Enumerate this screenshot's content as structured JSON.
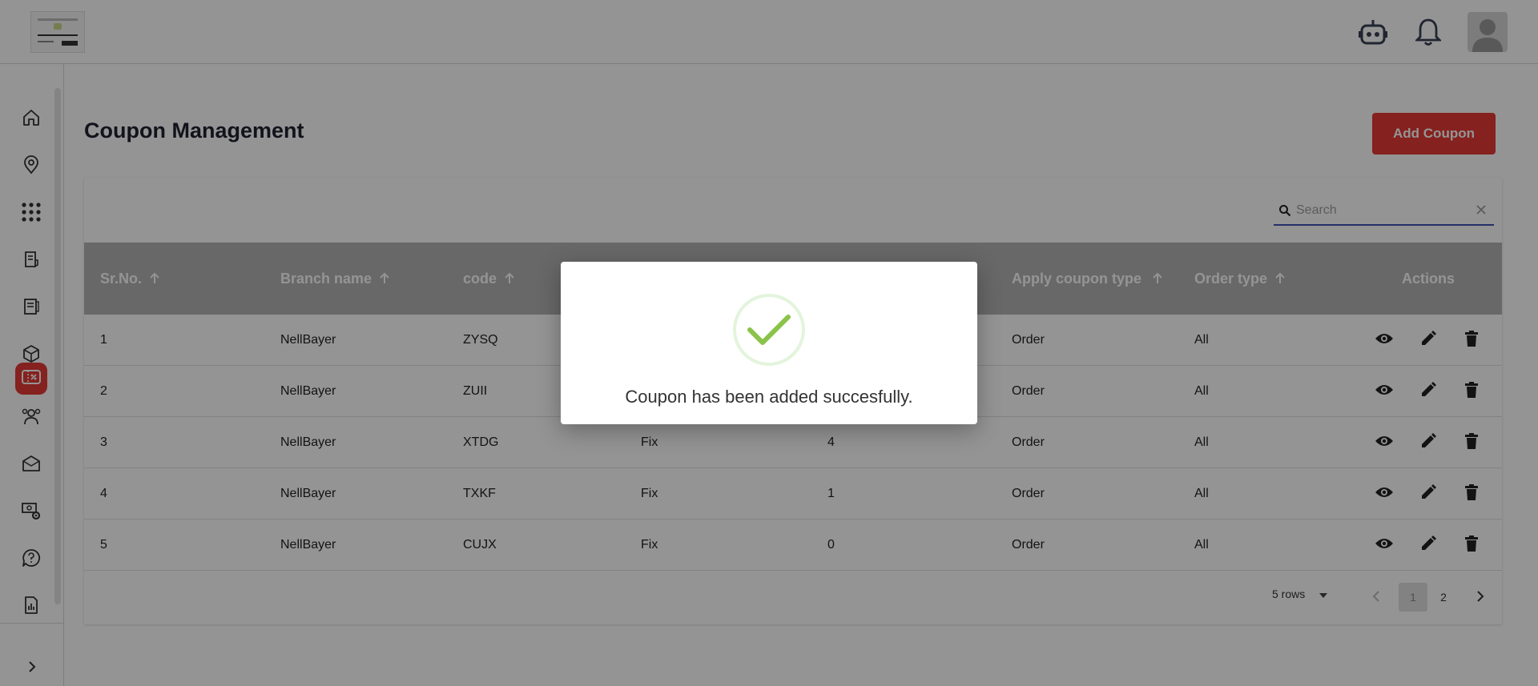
{
  "header": {
    "logo_alt": "logo",
    "icons": [
      "robot-icon",
      "bell-icon",
      "user-avatar"
    ]
  },
  "sidebar": {
    "items": [
      {
        "name": "home",
        "icon": "home-icon"
      },
      {
        "name": "location",
        "icon": "location-pin-icon"
      },
      {
        "name": "apps",
        "icon": "grid-dots-icon"
      },
      {
        "name": "orders",
        "icon": "receipt-icon"
      },
      {
        "name": "menu",
        "icon": "menu-book-icon"
      },
      {
        "name": "products",
        "icon": "box-icon"
      },
      {
        "name": "coupons",
        "icon": "coupon-icon",
        "active": true
      },
      {
        "name": "customers",
        "icon": "users-icon"
      },
      {
        "name": "messages",
        "icon": "mail-icon"
      },
      {
        "name": "payment-settings",
        "icon": "money-gear-icon"
      },
      {
        "name": "support",
        "icon": "chat-question-icon"
      },
      {
        "name": "reports",
        "icon": "report-icon"
      }
    ],
    "accent": "#e53935"
  },
  "page": {
    "title": "Coupon Management",
    "add_button": "Add Coupon"
  },
  "search": {
    "placeholder": "Search"
  },
  "table": {
    "headers": [
      "Sr.No.",
      "Branch name",
      "code",
      "",
      "",
      "Apply coupon type",
      "Order type",
      "Actions"
    ],
    "rows": [
      {
        "srno": "1",
        "branch": "NellBayer",
        "code": "ZYSQ",
        "type": "",
        "value": "",
        "apply": "Order",
        "order_type": "All"
      },
      {
        "srno": "2",
        "branch": "NellBayer",
        "code": "ZUII",
        "type": "",
        "value": "",
        "apply": "Order",
        "order_type": "All"
      },
      {
        "srno": "3",
        "branch": "NellBayer",
        "code": "XTDG",
        "type": "Fix",
        "value": "4",
        "apply": "Order",
        "order_type": "All"
      },
      {
        "srno": "4",
        "branch": "NellBayer",
        "code": "TXKF",
        "type": "Fix",
        "value": "1",
        "apply": "Order",
        "order_type": "All"
      },
      {
        "srno": "5",
        "branch": "NellBayer",
        "code": "CUJX",
        "type": "Fix",
        "value": "0",
        "apply": "Order",
        "order_type": "All"
      }
    ]
  },
  "pagination": {
    "rows_label": "5 rows",
    "pages": [
      "1",
      "2"
    ],
    "current": "1"
  },
  "modal": {
    "message": "Coupon has been added succesfully.",
    "icon": "success-check-icon",
    "check_color": "#8bc34a"
  }
}
